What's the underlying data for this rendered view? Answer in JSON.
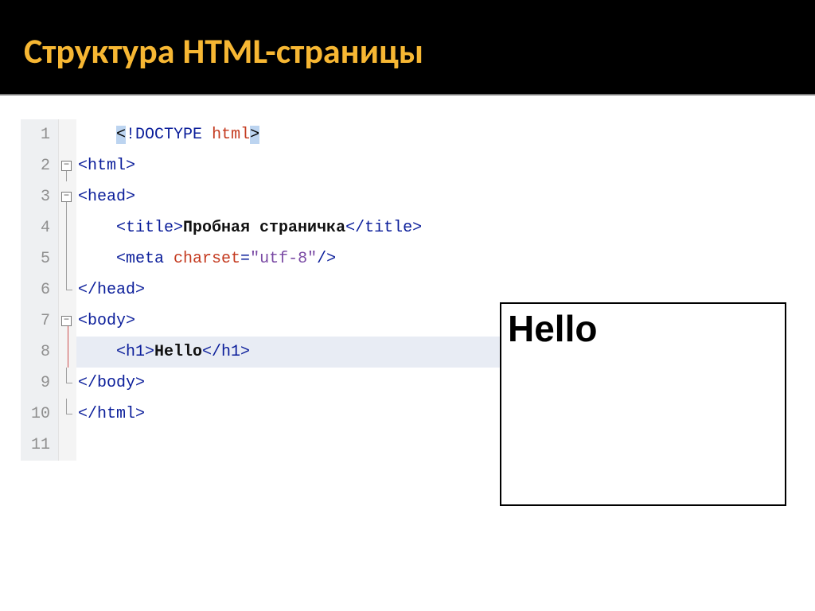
{
  "slide": {
    "title": "Структура HTML-страницы"
  },
  "editor": {
    "lines": [
      {
        "num": "1",
        "fold": "none",
        "indent": "    ",
        "tokens": [
          {
            "cls": "sel",
            "t": "<"
          },
          {
            "cls": "tag",
            "t": "!DOCTYPE"
          },
          {
            "cls": "",
            "t": " "
          },
          {
            "cls": "attr",
            "t": "html"
          },
          {
            "cls": "sel",
            "t": ">"
          }
        ]
      },
      {
        "num": "2",
        "fold": "box",
        "indent": "",
        "tokens": [
          {
            "cls": "tag",
            "t": "<html>"
          }
        ]
      },
      {
        "num": "3",
        "fold": "box",
        "indent": "",
        "tokens": [
          {
            "cls": "tag",
            "t": "<head>"
          }
        ]
      },
      {
        "num": "4",
        "fold": "line",
        "indent": "    ",
        "tokens": [
          {
            "cls": "tag",
            "t": "<title>"
          },
          {
            "cls": "txt",
            "t": "Пробная страничка"
          },
          {
            "cls": "tag",
            "t": "</title>"
          }
        ]
      },
      {
        "num": "5",
        "fold": "line",
        "indent": "    ",
        "tokens": [
          {
            "cls": "tag",
            "t": "<meta "
          },
          {
            "cls": "attr",
            "t": "charset"
          },
          {
            "cls": "tag",
            "t": "="
          },
          {
            "cls": "str",
            "t": "\"utf-8\""
          },
          {
            "cls": "tag",
            "t": "/>"
          }
        ]
      },
      {
        "num": "6",
        "fold": "end",
        "indent": "",
        "tokens": [
          {
            "cls": "tag",
            "t": "</head>"
          }
        ]
      },
      {
        "num": "7",
        "fold": "boxred",
        "indent": "",
        "tokens": [
          {
            "cls": "tag",
            "t": "<body>"
          }
        ]
      },
      {
        "num": "8",
        "fold": "linered",
        "highlight": true,
        "indent": "    ",
        "tokens": [
          {
            "cls": "tag",
            "t": "<h1>"
          },
          {
            "cls": "txt",
            "t": "Hello"
          },
          {
            "cls": "tag",
            "t": "</h1>"
          }
        ]
      },
      {
        "num": "9",
        "fold": "end",
        "indent": "",
        "tokens": [
          {
            "cls": "tag",
            "t": "</body>"
          }
        ]
      },
      {
        "num": "10",
        "fold": "end",
        "indent": "",
        "tokens": [
          {
            "cls": "tag",
            "t": "</html>"
          }
        ]
      },
      {
        "num": "11",
        "fold": "none",
        "indent": "",
        "tokens": []
      }
    ]
  },
  "preview": {
    "heading": "Hello"
  }
}
